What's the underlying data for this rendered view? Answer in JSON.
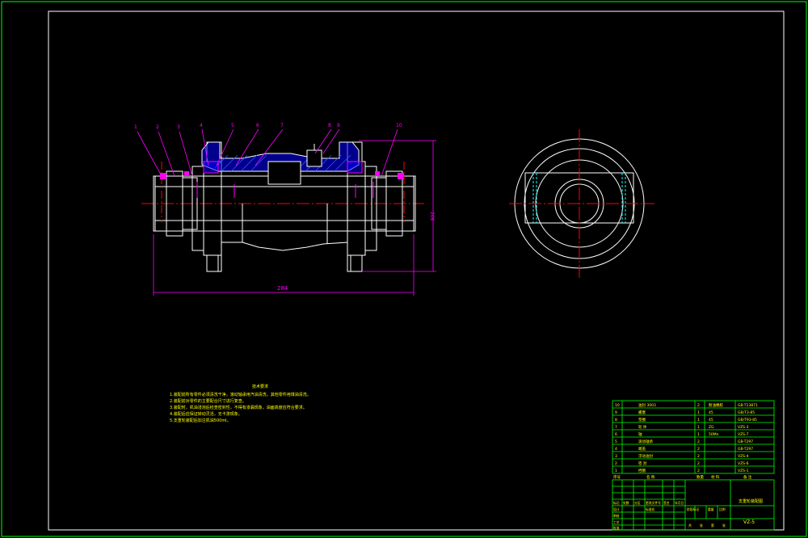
{
  "colors": {
    "background": "#000000",
    "border": "#00ff00",
    "outline": "#ffffff",
    "centerline": "#ff0000",
    "dimension": "#ff00ff",
    "hatch": "#0000ff",
    "hidden": "#00ffff",
    "leader": "#ff00ff",
    "notes": "#ffff00",
    "table_text": "#ffff00",
    "table_line": "#00ff00"
  },
  "leaders": [
    "1",
    "2",
    "3",
    "4",
    "5",
    "6",
    "7",
    "8",
    "9",
    "10"
  ],
  "dimensions": {
    "overall_length": "284",
    "overall_height": "206"
  },
  "notes": {
    "title": "技术要求",
    "lines": [
      "1.装配前所有零件必须清洗干净，滚动轴承用汽油清洗，其他零件用煤油清洗。",
      "2.装配前对零件的主要配合尺寸进行复查。",
      "3.装配时，机油浸泡后检查密封性，不得有渗漏现象，油面高度应符合要求。",
      "4.装配后应保证转动灵活，无卡滞现象。",
      "5.支重轮装配后加注机油500ml。"
    ]
  },
  "parts_list": [
    {
      "no": "10",
      "name": "油封 3003",
      "qty": "2",
      "material": "耐油橡胶",
      "code": "GB-T13871"
    },
    {
      "no": "9",
      "name": "螺塞",
      "qty": "1",
      "material": "45",
      "code": "GB/T3-85"
    },
    {
      "no": "8",
      "name": "垫圈",
      "qty": "1",
      "material": "45",
      "code": "GB/T93-85"
    },
    {
      "no": "7",
      "name": "轮 体",
      "qty": "1",
      "material": "ZG",
      "code": "VZS-3"
    },
    {
      "no": "6",
      "name": "轴",
      "qty": "1",
      "material": "50Mn",
      "code": "VZS-7"
    },
    {
      "no": "5",
      "name": "滚动轴承",
      "qty": "2",
      "material": "",
      "code": "GB-T297"
    },
    {
      "no": "4",
      "name": "端盖",
      "qty": "2",
      "material": "",
      "code": "GB-T297"
    },
    {
      "no": "3",
      "name": "浮动油封",
      "qty": "2",
      "material": "",
      "code": "VZS-4"
    },
    {
      "no": "2",
      "name": "密 封",
      "qty": "2",
      "material": "",
      "code": "VZS-6"
    },
    {
      "no": "1",
      "name": "挡圈",
      "qty": "2",
      "material": "",
      "code": "VZS-1"
    }
  ],
  "parts_header": {
    "no": "序号",
    "name": "名 称",
    "qty": "数量",
    "material": "材 料",
    "code": "备 注"
  },
  "title_block": {
    "drawing_title": "支重轮装配图",
    "drawing_no": "VZ-5",
    "labels": [
      "标记",
      "处数",
      "分区",
      "更改文件号",
      "签名",
      "年月日",
      "设计",
      "标准化",
      "审核",
      "工艺",
      "批准",
      "阶段标记",
      "重量",
      "比例",
      "共",
      "张",
      "第",
      "张"
    ]
  }
}
